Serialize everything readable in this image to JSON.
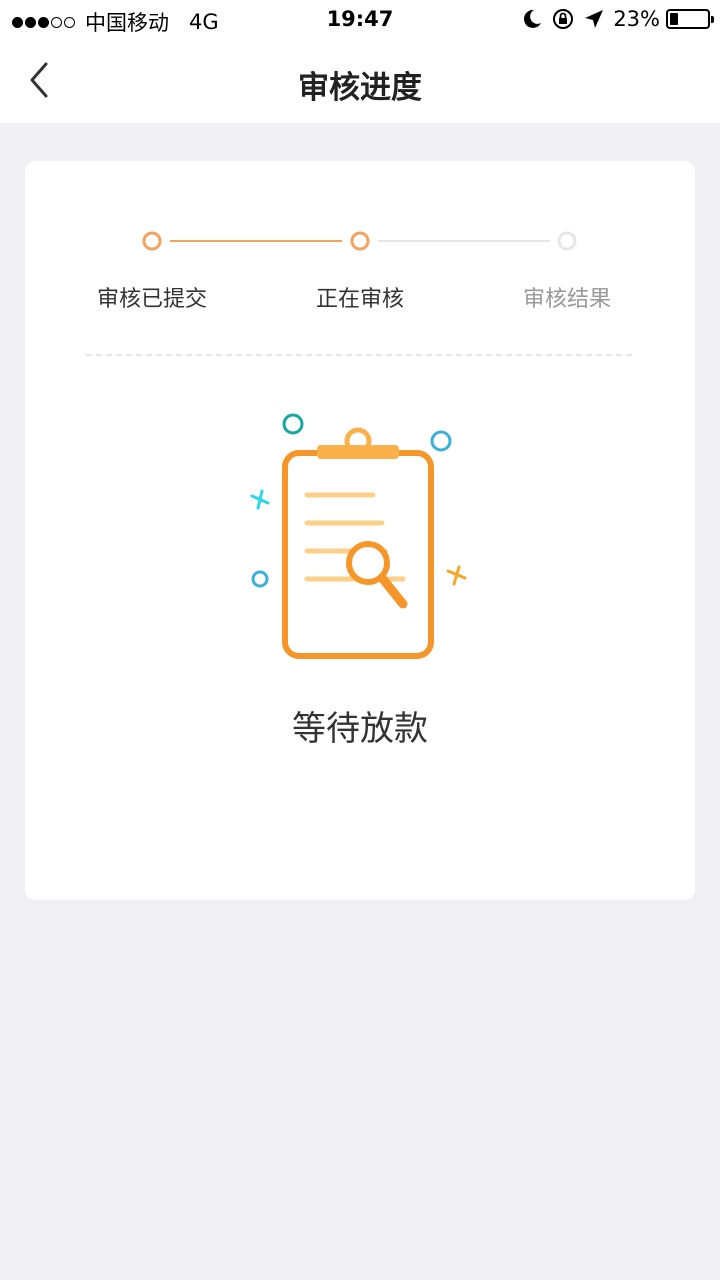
{
  "status_bar": {
    "carrier": "中国移动",
    "network": "4G",
    "time": "19:47",
    "battery": "23%",
    "battery_level": 0.23,
    "signal_bars_filled": 3,
    "signal_bars_total": 5
  },
  "nav": {
    "title": "审核进度",
    "back_icon": "chevron-left-icon"
  },
  "progress": {
    "steps": [
      {
        "label": "审核已提交",
        "state": "done"
      },
      {
        "label": "正在审核",
        "state": "current"
      },
      {
        "label": "审核结果",
        "state": "pending"
      }
    ],
    "colors": {
      "active": "#f5a25d",
      "inactive": "#e6e6e6"
    }
  },
  "result": {
    "icon": "clipboard-search-icon",
    "status": "等待放款"
  },
  "colors": {
    "orange": "#f5962a",
    "light_orange": "#fdd08a",
    "teal": "#17a7a1",
    "blue": "#3bb0d8",
    "cyan": "#2bd7e6"
  }
}
